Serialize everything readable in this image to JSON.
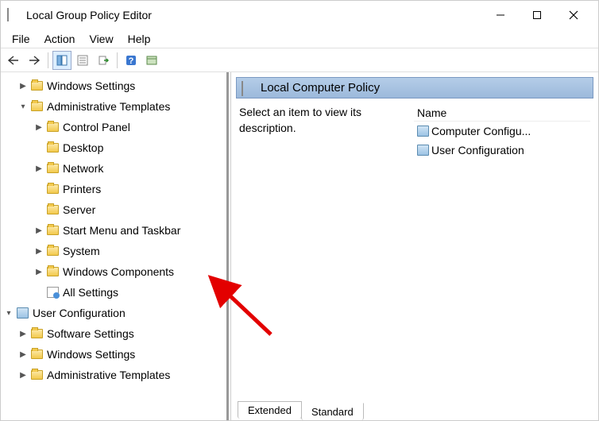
{
  "window": {
    "title": "Local Group Policy Editor"
  },
  "menubar": {
    "file": "File",
    "action": "Action",
    "view": "View",
    "help": "Help"
  },
  "tree": {
    "windows_settings": "Windows Settings",
    "admin_templates": "Administrative Templates",
    "control_panel": "Control Panel",
    "desktop": "Desktop",
    "network": "Network",
    "printers": "Printers",
    "server": "Server",
    "start_menu": "Start Menu and Taskbar",
    "system": "System",
    "windows_components": "Windows Components",
    "all_settings": "All Settings",
    "user_config": "User Configuration",
    "software_settings": "Software Settings",
    "windows_settings2": "Windows Settings",
    "admin_templates2": "Administrative Templates"
  },
  "right": {
    "header": "Local Computer Policy",
    "desc": "Select an item to view its description.",
    "col_name": "Name",
    "item1": "Computer Configu...",
    "item2": "User Configuration"
  },
  "tabs": {
    "extended": "Extended",
    "standard": "Standard"
  }
}
